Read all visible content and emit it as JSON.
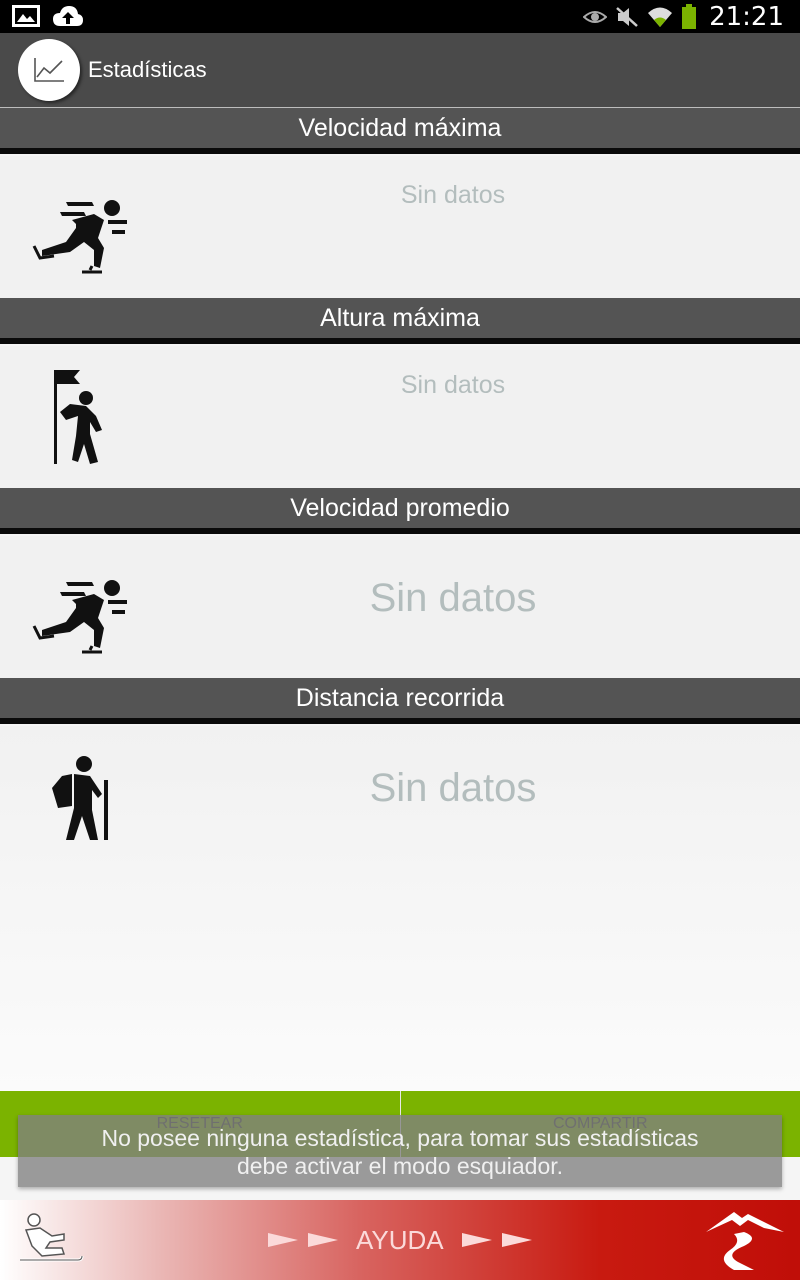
{
  "status_bar": {
    "time": "21:21",
    "icons": [
      "image-icon",
      "cloud-upload-icon",
      "eye-icon",
      "mute-icon",
      "wifi-icon",
      "battery-icon"
    ]
  },
  "action_bar": {
    "title": "Estadísticas",
    "logo_icon": "chart-line-icon"
  },
  "sections": [
    {
      "header": "Velocidad máxima",
      "value": "Sin datos",
      "icon": "skater-icon"
    },
    {
      "header": "Altura máxima",
      "value": "Sin datos",
      "icon": "summit-flag-icon"
    },
    {
      "header": "Velocidad promedio",
      "value": "Sin datos",
      "icon": "skater-icon"
    },
    {
      "header": "Distancia recorrida",
      "value": "Sin datos",
      "icon": "hiker-icon"
    }
  ],
  "buttons": {
    "reset": "RESETEAR",
    "share": "COMPARTIR"
  },
  "toast": {
    "line1": "No posee ninguna estadística, para tomar sus estadísticas",
    "line2": "debe activar el modo esquiador."
  },
  "bottom_bar": {
    "help_label": "AYUDA",
    "left_icon": "skier-icon",
    "right_icon": "mountain-road-icon"
  },
  "colors": {
    "action_bar": "#4a4a4a",
    "section_header": "#545454",
    "button_bar": "#7bb300",
    "bottom_bar_end": "#c00e08",
    "placeholder_text": "#b3bdbd"
  }
}
